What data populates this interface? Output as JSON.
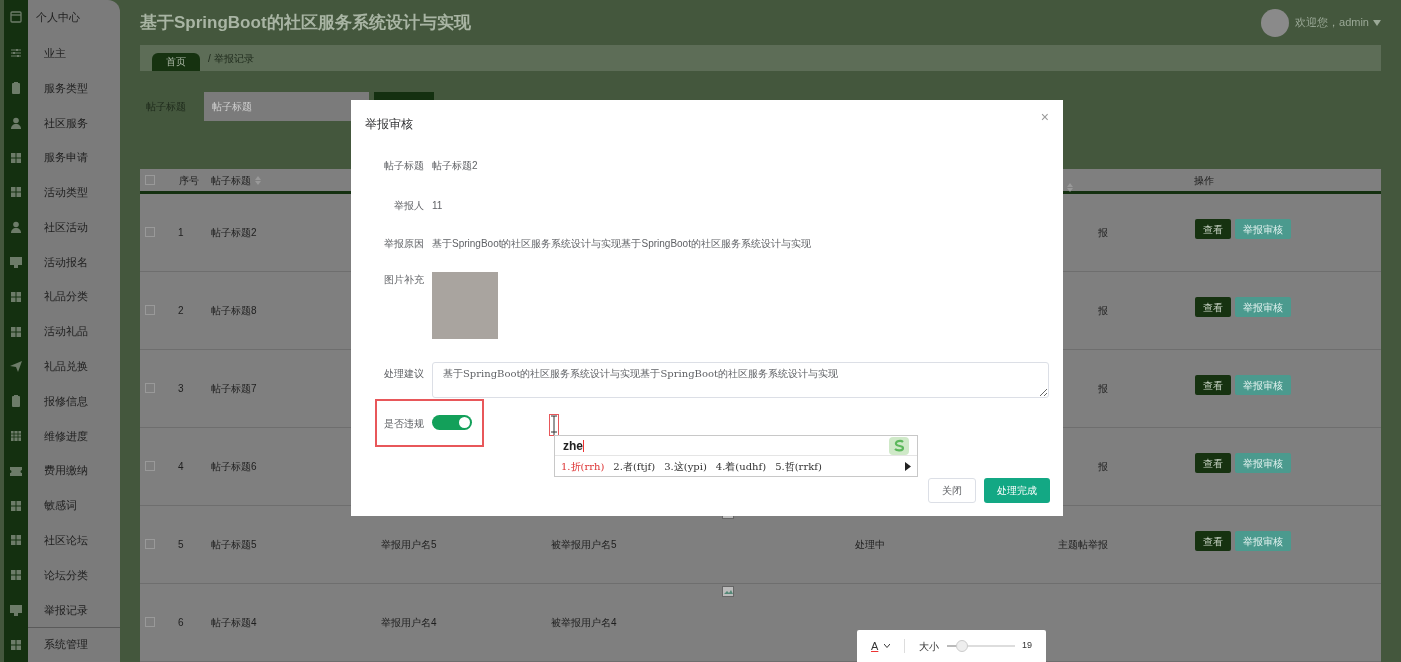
{
  "header": {
    "title": "基于SpringBoot的社区服务系统设计与实现",
    "user": "欢迎您，admin"
  },
  "sidebar": {
    "items": [
      {
        "label": "个人中心",
        "kind": "header"
      },
      {
        "label": "业主",
        "kind": "item"
      },
      {
        "label": "服务类型",
        "kind": "item"
      },
      {
        "label": "社区服务",
        "kind": "item"
      },
      {
        "label": "服务申请",
        "kind": "item"
      },
      {
        "label": "活动类型",
        "kind": "item"
      },
      {
        "label": "社区活动",
        "kind": "item"
      },
      {
        "label": "活动报名",
        "kind": "item"
      },
      {
        "label": "礼品分类",
        "kind": "item"
      },
      {
        "label": "活动礼品",
        "kind": "item"
      },
      {
        "label": "礼品兑换",
        "kind": "item"
      },
      {
        "label": "报修信息",
        "kind": "item"
      },
      {
        "label": "维修进度",
        "kind": "item"
      },
      {
        "label": "费用缴纳",
        "kind": "item"
      },
      {
        "label": "敏感词",
        "kind": "item"
      },
      {
        "label": "社区论坛",
        "kind": "item"
      },
      {
        "label": "论坛分类",
        "kind": "item"
      },
      {
        "label": "举报记录",
        "kind": "item"
      },
      {
        "label": "系统管理",
        "kind": "item"
      }
    ]
  },
  "breadcrumb": [
    "首页",
    "/ 举报记录"
  ],
  "search": {
    "label": "帖子标题",
    "placeholder": "帖子标题"
  },
  "table": {
    "select_all": false,
    "columns": [
      "序号",
      "帖子标题",
      "操作"
    ],
    "rows": [
      {
        "checked": false,
        "no": "1",
        "title": "帖子标题2",
        "type": "报",
        "actions": [
          "查看",
          "举报审核"
        ]
      },
      {
        "checked": false,
        "no": "2",
        "title": "帖子标题8",
        "type": "报",
        "actions": [
          "查看",
          "举报审核"
        ]
      },
      {
        "checked": false,
        "no": "3",
        "title": "帖子标题7",
        "type": "报",
        "actions": [
          "查看",
          "举报审核"
        ]
      },
      {
        "checked": false,
        "no": "4",
        "title": "帖子标题6",
        "type": "报",
        "actions": [
          "查看",
          "举报审核"
        ]
      },
      {
        "checked": false,
        "no": "5",
        "title": "帖子标题5",
        "reporter": "举报用户名5",
        "reported": "被举报用户名5",
        "image": true,
        "status": "处理中",
        "type": "主题帖举报",
        "actions": [
          "查看",
          "举报审核"
        ]
      },
      {
        "checked": false,
        "no": "6",
        "title": "帖子标题4",
        "reporter": "举报用户名4",
        "reported": "被举报用户名4",
        "image": true
      }
    ]
  },
  "dialog": {
    "title": "举报审核",
    "close": "×",
    "fields": [
      {
        "label": "帖子标题",
        "kind": "text",
        "value": "帖子标题2"
      },
      {
        "label": "举报人",
        "kind": "text",
        "value": "11"
      },
      {
        "label": "举报原因",
        "kind": "text",
        "value": "基于SpringBoot的社区服务系统设计与实现基于SpringBoot的社区服务系统设计与实现"
      },
      {
        "label": "图片补充",
        "kind": "image"
      },
      {
        "label": "处理建议",
        "kind": "textarea",
        "value": "基于SpringBoot的社区服务系统设计与实现基于SpringBoot的社区服务系统设计与实现"
      },
      {
        "label": "是否违规",
        "kind": "switch",
        "on": true
      }
    ],
    "buttons": [
      {
        "label": "关闭",
        "kind": "default"
      },
      {
        "label": "处理完成",
        "kind": "primary"
      }
    ]
  },
  "ime": {
    "input": "zhe",
    "candidates": [
      "1.折(rrh)",
      "2.者(ftjf)",
      "3.这(ypi)",
      "4.着(udhf)",
      "5.哲(rrkf)"
    ]
  },
  "toolbar": {
    "font_label": "A",
    "size_label": "大小",
    "size": {
      "level": 0.15
    },
    "size_value": "19"
  }
}
